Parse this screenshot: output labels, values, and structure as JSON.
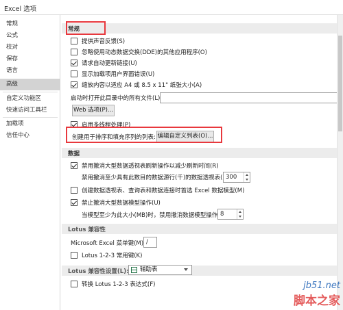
{
  "window": {
    "title": "Excel 选项"
  },
  "sidebar": {
    "items": [
      {
        "label": "常规"
      },
      {
        "label": "公式"
      },
      {
        "label": "校对"
      },
      {
        "label": "保存"
      },
      {
        "label": "语言"
      },
      {
        "label": "高级",
        "active": true
      },
      {
        "label": "自定义功能区"
      },
      {
        "label": "快速访问工具栏"
      },
      {
        "label": "加载项"
      },
      {
        "label": "信任中心"
      }
    ]
  },
  "general": {
    "header": "常规",
    "options": [
      {
        "label": "提供声音反馈(S)",
        "checked": false
      },
      {
        "label": "忽略使用动态数据交换(DDE)的其他应用程序(O)",
        "checked": false
      },
      {
        "label": "请求自动更新链接(U)",
        "checked": true
      },
      {
        "label": "显示加载项用户界面错误(U)",
        "checked": false
      },
      {
        "label": "缩放内容以适应 A4 或 8.5 x 11\" 纸张大小(A)",
        "checked": true
      }
    ],
    "startup_label": "启动时打开此目录中的所有文件(L):",
    "startup_value": "",
    "web_options_button": "Web 选项(P)...",
    "multithread_label": "启用多线程处理(P)",
    "multithread_checked": true,
    "custom_list_label": "创建用于排序和填充序列的列表:",
    "edit_custom_list_button": "编辑自定义列表(O)..."
  },
  "data": {
    "header": "数据",
    "disable_undo_pivot_label": "禁用撤消大型数据透视表刷新操作以减少刷新时间(R)",
    "disable_undo_pivot_checked": true,
    "pivot_rows_label": "禁用撤消至少具有此数目的数据源行(千)的数据透视表(N):",
    "pivot_rows_value": "300",
    "prefer_model_label": "创建数据透视表、查询表和数据连接时首选 Excel 数据模型(M)",
    "prefer_model_checked": false,
    "disable_undo_model_label": "禁止撤消大型数据模型操作(U)",
    "disable_undo_model_checked": true,
    "model_size_label": "当模型至少为此大小(MB)时，禁用撤消数据模型操作(L):",
    "model_size_value": "8"
  },
  "lotus_compat": {
    "header": "Lotus 兼容性",
    "menu_key_label": "Microsoft Excel 菜单键(M):",
    "menu_key_value": "/",
    "nav_keys_label": "Lotus 1-2-3 常用键(K)",
    "nav_keys_checked": false
  },
  "lotus_settings": {
    "header_label": "Lotus 兼容性设置(L):",
    "sheet_value": "辅助表",
    "transition_formula_label": "转换 Lotus 1-2-3 表达式(F)",
    "transition_formula_checked": false
  },
  "watermark": {
    "site": "jb51.net",
    "text": "脚本之家"
  }
}
